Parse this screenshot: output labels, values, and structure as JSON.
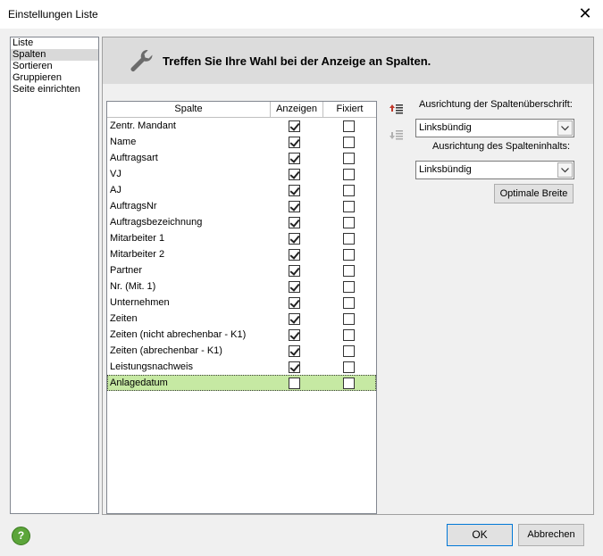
{
  "window": {
    "title": "Einstellungen Liste"
  },
  "nav": {
    "items": [
      "Liste",
      "Spalten",
      "Sortieren",
      "Gruppieren",
      "Seite einrichten"
    ],
    "selected": "Spalten"
  },
  "banner": {
    "heading": "Treffen Sie Ihre Wahl bei der Anzeige an Spalten."
  },
  "grid": {
    "headers": {
      "spalte": "Spalte",
      "anzeigen": "Anzeigen",
      "fixiert": "Fixiert"
    },
    "rows": [
      {
        "name": "Zentr. Mandant",
        "anzeigen": true,
        "fixiert": false
      },
      {
        "name": "Name",
        "anzeigen": true,
        "fixiert": false
      },
      {
        "name": "Auftragsart",
        "anzeigen": true,
        "fixiert": false
      },
      {
        "name": "VJ",
        "anzeigen": true,
        "fixiert": false
      },
      {
        "name": "AJ",
        "anzeigen": true,
        "fixiert": false
      },
      {
        "name": "AuftragsNr",
        "anzeigen": true,
        "fixiert": false
      },
      {
        "name": "Auftragsbezeichnung",
        "anzeigen": true,
        "fixiert": false
      },
      {
        "name": "Mitarbeiter 1",
        "anzeigen": true,
        "fixiert": false
      },
      {
        "name": "Mitarbeiter 2",
        "anzeigen": true,
        "fixiert": false
      },
      {
        "name": "Partner",
        "anzeigen": true,
        "fixiert": false
      },
      {
        "name": "Nr. (Mit. 1)",
        "anzeigen": true,
        "fixiert": false
      },
      {
        "name": "Unternehmen",
        "anzeigen": true,
        "fixiert": false
      },
      {
        "name": "Zeiten",
        "anzeigen": true,
        "fixiert": false
      },
      {
        "name": "Zeiten (nicht abrechenbar - K1)",
        "anzeigen": true,
        "fixiert": false
      },
      {
        "name": "Zeiten (abrechenbar - K1)",
        "anzeigen": true,
        "fixiert": false
      },
      {
        "name": "Leistungsnachweis",
        "anzeigen": true,
        "fixiert": false
      },
      {
        "name": "Anlagedatum",
        "anzeigen": false,
        "fixiert": false,
        "selected": true
      }
    ]
  },
  "options": {
    "header_align_label": "Ausrichtung der Spaltenüberschrift:",
    "header_align_value": "Linksbündig",
    "content_align_label": "Ausrichtung des Spalteninhalts:",
    "content_align_value": "Linksbündig",
    "optimal_width_button": "Optimale Breite"
  },
  "footer": {
    "ok": "OK",
    "cancel": "Abbrechen"
  },
  "colors": {
    "selected_row": "#c6e9a3",
    "banner": "#dcdcdc",
    "help": "#5ca53a"
  }
}
